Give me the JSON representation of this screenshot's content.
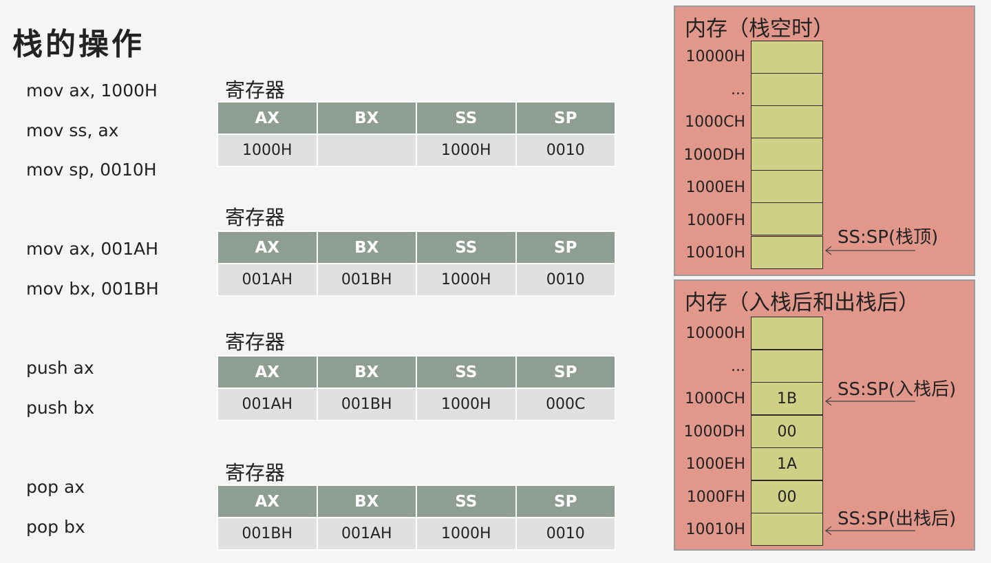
{
  "title": "栈的操作",
  "code_lines": [
    "mov ax, 1000H",
    "mov ss, ax",
    "mov sp, 0010H",
    "mov ax, 001AH",
    "mov bx, 001BH",
    "push ax",
    "push bx",
    "pop ax",
    "pop bx"
  ],
  "register_tables": [
    {
      "caption": "寄存器",
      "headers": [
        "AX",
        "BX",
        "SS",
        "SP"
      ],
      "values": [
        "1000H",
        "",
        "1000H",
        "0010"
      ]
    },
    {
      "caption": "寄存器",
      "headers": [
        "AX",
        "BX",
        "SS",
        "SP"
      ],
      "values": [
        "001AH",
        "001BH",
        "1000H",
        "0010"
      ]
    },
    {
      "caption": "寄存器",
      "headers": [
        "AX",
        "BX",
        "SS",
        "SP"
      ],
      "values": [
        "001AH",
        "001BH",
        "1000H",
        "000C"
      ]
    },
    {
      "caption": "寄存器",
      "headers": [
        "AX",
        "BX",
        "SS",
        "SP"
      ],
      "values": [
        "001BH",
        "001AH",
        "1000H",
        "0010"
      ]
    }
  ],
  "memory_panels": [
    {
      "title": "内存（栈空时）",
      "addresses": [
        "10000H",
        "...",
        "1000CH",
        "1000DH",
        "1000EH",
        "1000FH",
        "10010H"
      ],
      "cells": [
        "",
        "",
        "",
        "",
        "",
        "",
        ""
      ],
      "labels": [
        "SS:SP(栈顶)"
      ]
    },
    {
      "title": "内存（入栈后和出栈后）",
      "addresses": [
        "10000H",
        "...",
        "1000CH",
        "1000DH",
        "1000EH",
        "1000FH",
        "10010H"
      ],
      "cells": [
        "",
        "",
        "1B",
        "00",
        "1A",
        "00",
        ""
      ],
      "labels": [
        "SS:SP(入栈后)",
        "SS:SP(出栈后)"
      ]
    }
  ],
  "colors": {
    "header_bg": "#8f9e92",
    "value_bg": "#dfe1e1",
    "panel_bg": "#e2978b",
    "cell_bg": "#cfcf86"
  }
}
